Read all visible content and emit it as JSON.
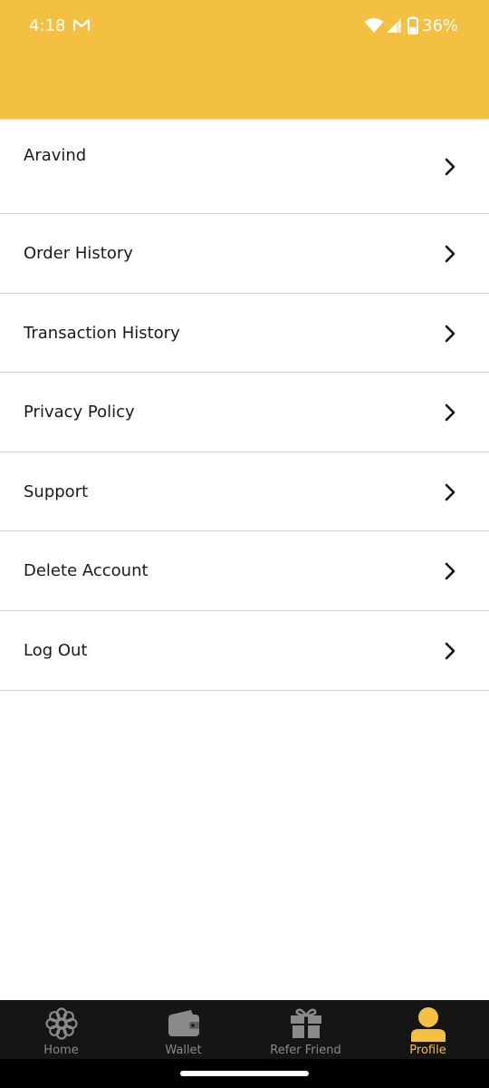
{
  "status_bar": {
    "time": "4:18",
    "battery": "36%"
  },
  "menu": {
    "items": [
      {
        "label": "Aravind"
      },
      {
        "label": "Order History"
      },
      {
        "label": "Transaction History"
      },
      {
        "label": "Privacy Policy"
      },
      {
        "label": "Support"
      },
      {
        "label": "Delete Account"
      },
      {
        "label": "Log Out"
      }
    ]
  },
  "bottom_nav": {
    "items": [
      {
        "label": "Home",
        "icon": "flower-icon"
      },
      {
        "label": "Wallet",
        "icon": "wallet-icon"
      },
      {
        "label": "Refer Friend",
        "icon": "gift-icon"
      },
      {
        "label": "Profile",
        "icon": "profile-icon"
      }
    ],
    "active": "Profile"
  },
  "colors": {
    "accent": "#F4C042",
    "nav_background": "#151515",
    "nav_inactive": "#8a8a8a"
  }
}
